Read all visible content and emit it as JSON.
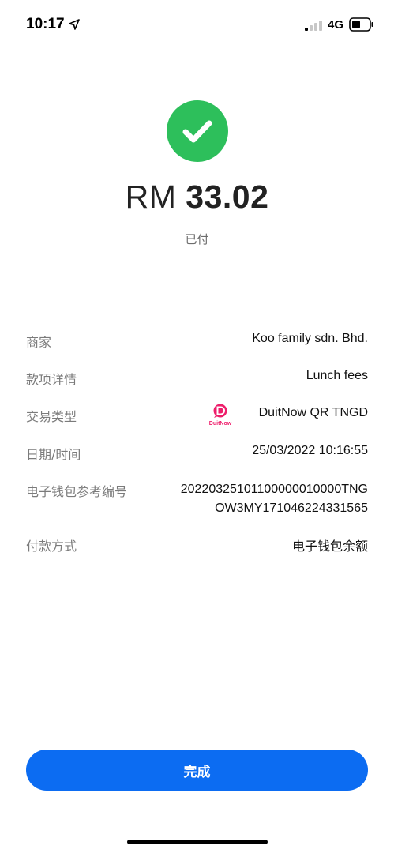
{
  "status_bar": {
    "time": "10:17",
    "network": "4G",
    "icons": [
      "location-arrow-icon",
      "signal-icon",
      "battery-icon"
    ]
  },
  "result": {
    "icon": "success-check-icon",
    "currency": "RM",
    "amount": "33.02",
    "status": "已付"
  },
  "details": [
    {
      "label": "商家",
      "value": "Koo family sdn. Bhd."
    },
    {
      "label": "款项详情",
      "value": "Lunch fees"
    },
    {
      "label": "交易类型",
      "value": "DuitNow QR TNGD",
      "icon": "duitnow-logo",
      "logo_text": "DuitNow"
    },
    {
      "label": "日期/时间",
      "value": "25/03/2022 10:16:55"
    },
    {
      "label": "电子钱包参考编号",
      "value_line1": "20220325101100000010000TNG",
      "value_line2": "OW3MY171046224331565"
    },
    {
      "label": "付款方式",
      "value": "电子钱包余额"
    }
  ],
  "done_button": {
    "label": "完成"
  },
  "colors": {
    "accent": "#0c6cf2",
    "success": "#2dbf5b",
    "duitnow": "#ee1e6b"
  }
}
